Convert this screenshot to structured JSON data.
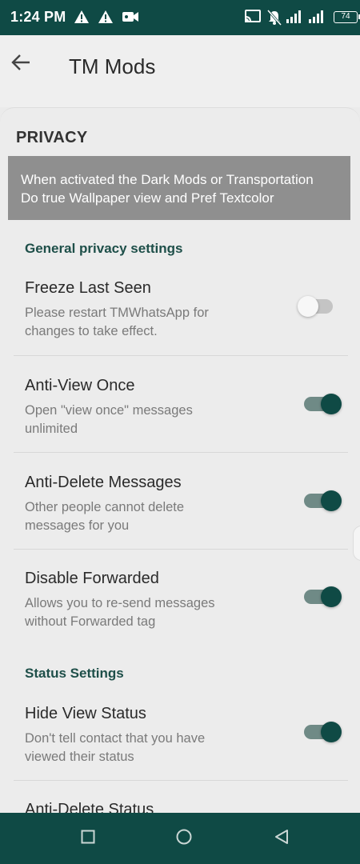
{
  "status_bar": {
    "time": "1:24 PM",
    "battery": "74",
    "icons": [
      "warning-icon",
      "warning-icon",
      "video-icon",
      "cast-icon",
      "mute-bell-icon",
      "signal-icon",
      "signal-icon",
      "battery-icon"
    ]
  },
  "app_bar": {
    "title": "TM Mods",
    "back_icon": "arrow-back-icon"
  },
  "section": {
    "header": "PRIVACY",
    "banner_line1": "When activated the Dark Mods or Transportation",
    "banner_line2": "Do true Wallpaper view and Pref Textcolor"
  },
  "groups": {
    "general_title": "General privacy settings",
    "status_title": "Status Settings"
  },
  "prefs": [
    {
      "title": "Freeze Last Seen",
      "summary_line1": "Please restart TMWhatsApp for",
      "summary_line2": "changes to take effect.",
      "enabled": false
    },
    {
      "title": "Anti-View Once",
      "summary_line1": "Open \"view once\" messages",
      "summary_line2": "unlimited",
      "enabled": true
    },
    {
      "title": "Anti-Delete Messages",
      "summary_line1": "Other people cannot delete",
      "summary_line2": "messages for you",
      "enabled": true
    },
    {
      "title": "Disable Forwarded",
      "summary_line1": "Allows you to re-send messages",
      "summary_line2": "without Forwarded tag",
      "enabled": true
    },
    {
      "title": "Hide View Status",
      "summary_line1": "Don't tell contact that you have",
      "summary_line2": "viewed their status",
      "enabled": true
    },
    {
      "title": "Anti-Delete Status"
    }
  ],
  "colors": {
    "primary": "#0f4a45",
    "accent_text": "#1e4f49",
    "banner": "#8f8f8f",
    "background": "#ececec"
  },
  "nav_bar": {
    "icons": [
      "recents-square-icon",
      "home-circle-icon",
      "back-triangle-icon"
    ]
  }
}
